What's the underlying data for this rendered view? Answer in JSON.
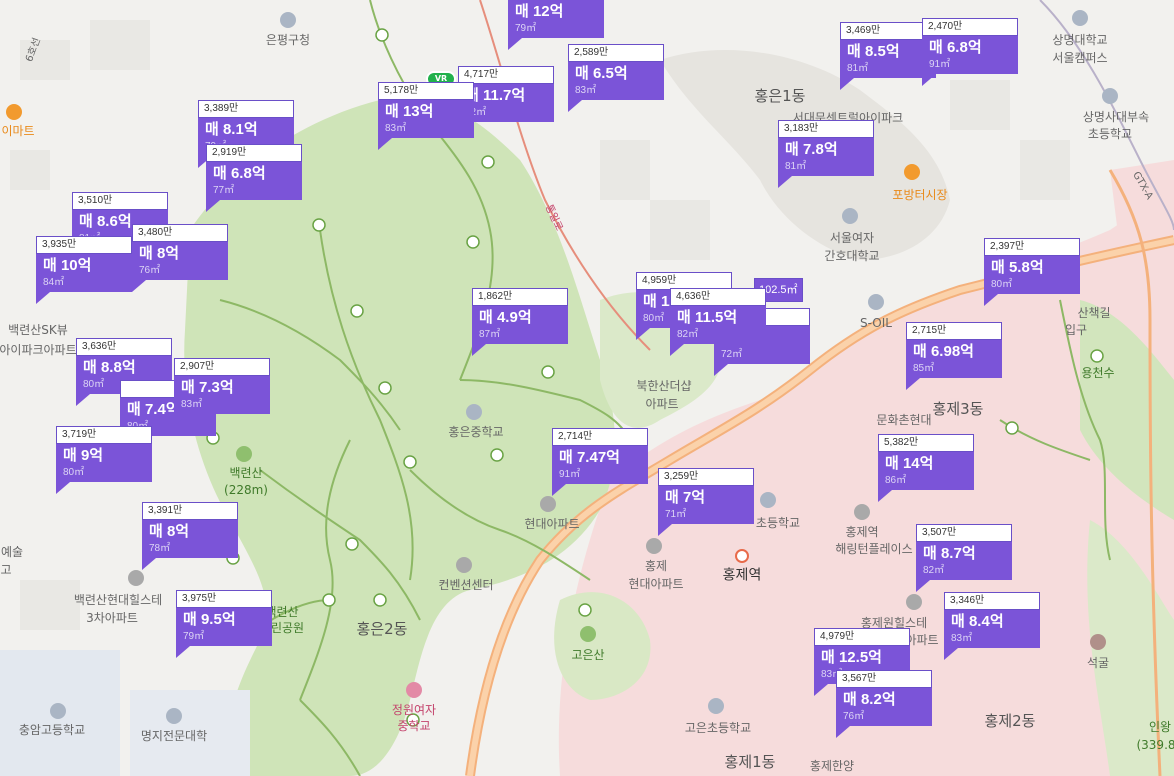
{
  "labels": {
    "eunpyeong_office": "은평구청",
    "emart": "이마트",
    "baekryeonsan_sk_1": "백련산SK뷰",
    "baekryeonsan_sk_2": "아이파크아파트",
    "baekryeonsan": "백련산",
    "baekryeonsan_height": "(228m)",
    "park_1": "백련산",
    "park_2": "근린공원",
    "hill_apt_1": "백련산현대힐스테",
    "hill_apt_2": "3차아파트",
    "art_1": "예술",
    "art_2": "고",
    "chungam": "충암고등학교",
    "myongji": "명지전문대학",
    "jeongwon_1": "정원여자",
    "jeongwon_2": "중학교",
    "hongeun2": "홍은2동",
    "convention": "컨벤션센터",
    "hyundai_apt": "현대아파트",
    "hongeun_middle": "홍은중학교",
    "bukhansan_1": "북한산더샵",
    "bukhansan_2": "아파트",
    "hongeun1": "홍은1동",
    "hongeun_apt": "서대문센트럴아이파크",
    "pohang_market": "포방터시장",
    "seoul_nursing_1": "서울여자",
    "seoul_nursing_2": "간호대학교",
    "soil": "S-OIL",
    "sangmyung_1": "상명대학교",
    "sangmyung_2": "서울캠퍼스",
    "sangmyung_elem_1": "상명사대부속",
    "sangmyung_elem_2": "초등학교",
    "hongje3": "홍제3동",
    "culture_1": "문화촌현대",
    "hongje_elem": "초등학교",
    "hongje_station": "홍제역",
    "hongje_hyundai_1": "홍제",
    "hongje_hyundai_2": "현대아파트",
    "goeunsan": "고은산",
    "goeun_elem": "고은초등학교",
    "hongje1": "홍제1동",
    "hongje_hanyang": "홍제한양",
    "hongje_hill_1": "홍제역",
    "hongje_hill_2": "해링턴플레이스",
    "hongje_won_1": "홍제원힐스테",
    "hongje_won_2": "아파트",
    "hongje2": "홍제2동",
    "seokgul": "석굴",
    "yongcheonsu": "용천수",
    "entrance_1": "산책길",
    "entrance_2": "입구",
    "inwang_1": "인왕",
    "inwang_2": "(339.8",
    "road_sign": "통일로",
    "road_sign_2": "6호선",
    "road_gtx": "GTX-A"
  },
  "vr_badge": "VR",
  "markers": [
    {
      "id": "m1",
      "price_tag": "",
      "price": "매 12억",
      "area": "79㎡"
    },
    {
      "id": "m2",
      "price_tag": "2,589만",
      "price": "매 6.5억",
      "area": "83㎡"
    },
    {
      "id": "m3",
      "price_tag": "4,717만",
      "price": "매 11.7억",
      "area": "82㎡"
    },
    {
      "id": "m4",
      "price_tag": "5,178만",
      "price": "매 13억",
      "area": "83㎡"
    },
    {
      "id": "m5",
      "price_tag": "3,389만",
      "price": "매 8.1억",
      "area": "79㎡"
    },
    {
      "id": "m6",
      "price_tag": "2,919만",
      "price": "매 6.8억",
      "area": "77㎡"
    },
    {
      "id": "m7",
      "price_tag": "3,510만",
      "price": "매 8.6억",
      "area": "81㎡"
    },
    {
      "id": "m8",
      "price_tag": "3,480만",
      "price": "매 8억",
      "area": "76㎡"
    },
    {
      "id": "m9",
      "price_tag": "3,935만",
      "price": "매 10억",
      "area": "84㎡"
    },
    {
      "id": "m10",
      "price_tag": "3,636만",
      "price": "매 8.8억",
      "area": "80㎡"
    },
    {
      "id": "m11",
      "price_tag": "",
      "price": "매 7.4억",
      "area": "80㎡"
    },
    {
      "id": "m12",
      "price_tag": "2,907만",
      "price": "매 7.3억",
      "area": "83㎡"
    },
    {
      "id": "m13",
      "price_tag": "3,719만",
      "price": "매 9억",
      "area": "80㎡"
    },
    {
      "id": "m14",
      "price_tag": "3,391만",
      "price": "매 8억",
      "area": "78㎡"
    },
    {
      "id": "m15",
      "price_tag": "3,975만",
      "price": "매 9.5억",
      "area": "79㎡"
    },
    {
      "id": "m16",
      "price_tag": "1,862만",
      "price": "매 4.9억",
      "area": "87㎡"
    },
    {
      "id": "m17",
      "price_tag": "2,714만",
      "price": "매 7.47억",
      "area": "91㎡"
    },
    {
      "id": "m18",
      "price_tag": "3,259만",
      "price": "매 7억",
      "area": "71㎡"
    },
    {
      "id": "m19",
      "price_tag": "4,959만",
      "price": "매 12억",
      "area": "80㎡"
    },
    {
      "id": "m20",
      "price_tag": "",
      "price": "매 9억",
      "area": "72㎡"
    },
    {
      "id": "m21",
      "price_tag": "4,636만",
      "price": "매 11.5억",
      "area": "82㎡"
    },
    {
      "id": "m22",
      "price_tag": "3,469만",
      "price": "매 8.5억",
      "area": "81㎡"
    },
    {
      "id": "m23",
      "price_tag": "2,470만",
      "price": "매 6.8억",
      "area": "91㎡"
    },
    {
      "id": "m24",
      "price_tag": "3,183만",
      "price": "매 7.8억",
      "area": "81㎡"
    },
    {
      "id": "m25",
      "price_tag": "2,397만",
      "price": "매 5.8억",
      "area": "80㎡"
    },
    {
      "id": "m26",
      "price_tag": "2,715만",
      "price": "매 6.98억",
      "area": "85㎡"
    },
    {
      "id": "m27",
      "price_tag": "5,382만",
      "price": "매 14억",
      "area": "86㎡"
    },
    {
      "id": "m28",
      "price_tag": "3,507만",
      "price": "매 8.7억",
      "area": "82㎡"
    },
    {
      "id": "m29",
      "price_tag": "3,346만",
      "price": "매 8.4억",
      "area": "83㎡"
    },
    {
      "id": "m30",
      "price_tag": "4,979만",
      "price": "매 12.5억",
      "area": "83㎡"
    },
    {
      "id": "m31",
      "price_tag": "3,567만",
      "price": "매 8.2억",
      "area": "76㎡"
    }
  ],
  "mini_marker": "102.5㎡"
}
